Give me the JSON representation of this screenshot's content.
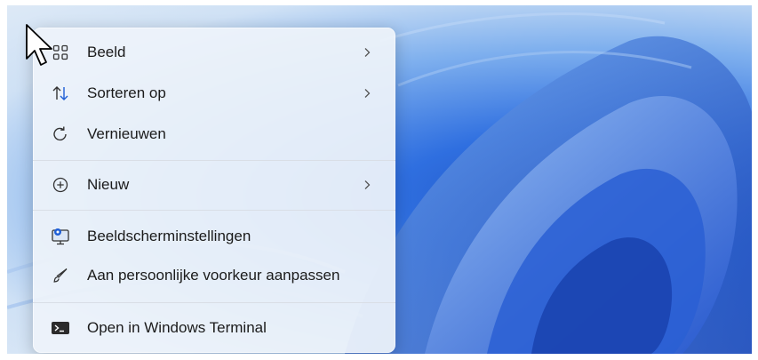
{
  "context_menu": {
    "items": [
      {
        "label": "Beeld",
        "icon": "view-grid-icon",
        "has_submenu": true
      },
      {
        "label": "Sorteren op",
        "icon": "sort-arrows-icon",
        "has_submenu": true
      },
      {
        "label": "Vernieuwen",
        "icon": "refresh-icon",
        "has_submenu": false
      },
      {
        "label": "Nieuw",
        "icon": "plus-circle-icon",
        "has_submenu": true
      },
      {
        "label": "Beeldscherminstellingen",
        "icon": "display-settings-icon",
        "has_submenu": false
      },
      {
        "label": "Aan persoonlijke voorkeur aanpassen",
        "icon": "brush-icon",
        "has_submenu": false
      },
      {
        "label": "Open in Windows Terminal",
        "icon": "terminal-icon",
        "has_submenu": false
      }
    ]
  },
  "colors": {
    "accent": "#1f5fd6",
    "menu_background": "#eef3fa",
    "wallpaper_deep": "#1e4fbf"
  }
}
